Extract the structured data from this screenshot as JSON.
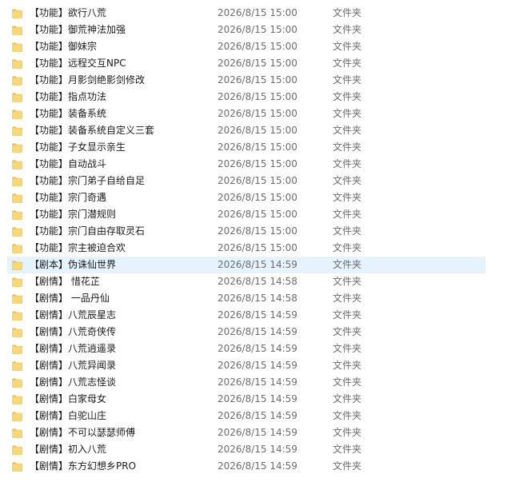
{
  "colors": {
    "hover_row": "#e5f3ff",
    "folder_body": "#f8d775",
    "folder_tab": "#e8b949",
    "secondary_text": "#6d6d6d"
  },
  "file_list": {
    "hovered_index": 15,
    "rows": [
      {
        "name": "【功能】欲行八荒",
        "date": "2026/8/15 15:00",
        "type": "文件夹"
      },
      {
        "name": "【功能】御荒神法加强",
        "date": "2026/8/15 15:00",
        "type": "文件夹"
      },
      {
        "name": "【功能】御妹宗",
        "date": "2026/8/15 15:00",
        "type": "文件夹"
      },
      {
        "name": "【功能】远程交互NPC",
        "date": "2026/8/15 15:00",
        "type": "文件夹"
      },
      {
        "name": "【功能】月影剑绝影剑修改",
        "date": "2026/8/15 15:00",
        "type": "文件夹"
      },
      {
        "name": "【功能】指点功法",
        "date": "2026/8/15 15:00",
        "type": "文件夹"
      },
      {
        "name": "【功能】装备系统",
        "date": "2026/8/15 15:00",
        "type": "文件夹"
      },
      {
        "name": "【功能】装备系统自定义三套",
        "date": "2026/8/15 15:00",
        "type": "文件夹"
      },
      {
        "name": "【功能】子女显示亲生",
        "date": "2026/8/15 15:00",
        "type": "文件夹"
      },
      {
        "name": "【功能】自动战斗",
        "date": "2026/8/15 15:00",
        "type": "文件夹"
      },
      {
        "name": "【功能】宗门弟子自给自足",
        "date": "2026/8/15 15:00",
        "type": "文件夹"
      },
      {
        "name": "【功能】宗门奇遇",
        "date": "2026/8/15 15:00",
        "type": "文件夹"
      },
      {
        "name": "【功能】宗门潜规则",
        "date": "2026/8/15 15:00",
        "type": "文件夹"
      },
      {
        "name": "【功能】宗门自由存取灵石",
        "date": "2026/8/15 15:00",
        "type": "文件夹"
      },
      {
        "name": "【功能】宗主被迫合欢",
        "date": "2026/8/15 15:00",
        "type": "文件夹"
      },
      {
        "name": "【剧本】伪诛仙世界",
        "date": "2026/8/15 14:59",
        "type": "文件夹"
      },
      {
        "name": "【剧情】 惜花芷",
        "date": "2026/8/15 14:58",
        "type": "文件夹"
      },
      {
        "name": "【剧情】 一品丹仙",
        "date": "2026/8/15 14:58",
        "type": "文件夹"
      },
      {
        "name": "【剧情】八荒辰星志",
        "date": "2026/8/15 14:59",
        "type": "文件夹"
      },
      {
        "name": "【剧情】八荒奇侠传",
        "date": "2026/8/15 14:59",
        "type": "文件夹"
      },
      {
        "name": "【剧情】八荒逍遥录",
        "date": "2026/8/15 14:59",
        "type": "文件夹"
      },
      {
        "name": "【剧情】八荒异闻录",
        "date": "2026/8/15 14:59",
        "type": "文件夹"
      },
      {
        "name": "【剧情】八荒志怪谈",
        "date": "2026/8/15 14:59",
        "type": "文件夹"
      },
      {
        "name": "【剧情】白家母女",
        "date": "2026/8/15 14:59",
        "type": "文件夹"
      },
      {
        "name": "【剧情】白驼山庄",
        "date": "2026/8/15 14:59",
        "type": "文件夹"
      },
      {
        "name": "【剧情】不可以瑟瑟师傅",
        "date": "2026/8/15 14:59",
        "type": "文件夹"
      },
      {
        "name": "【剧情】初入八荒",
        "date": "2026/8/15 14:59",
        "type": "文件夹"
      },
      {
        "name": "【剧情】东方幻想乡PRO",
        "date": "2026/8/15 14:59",
        "type": "文件夹"
      }
    ]
  }
}
